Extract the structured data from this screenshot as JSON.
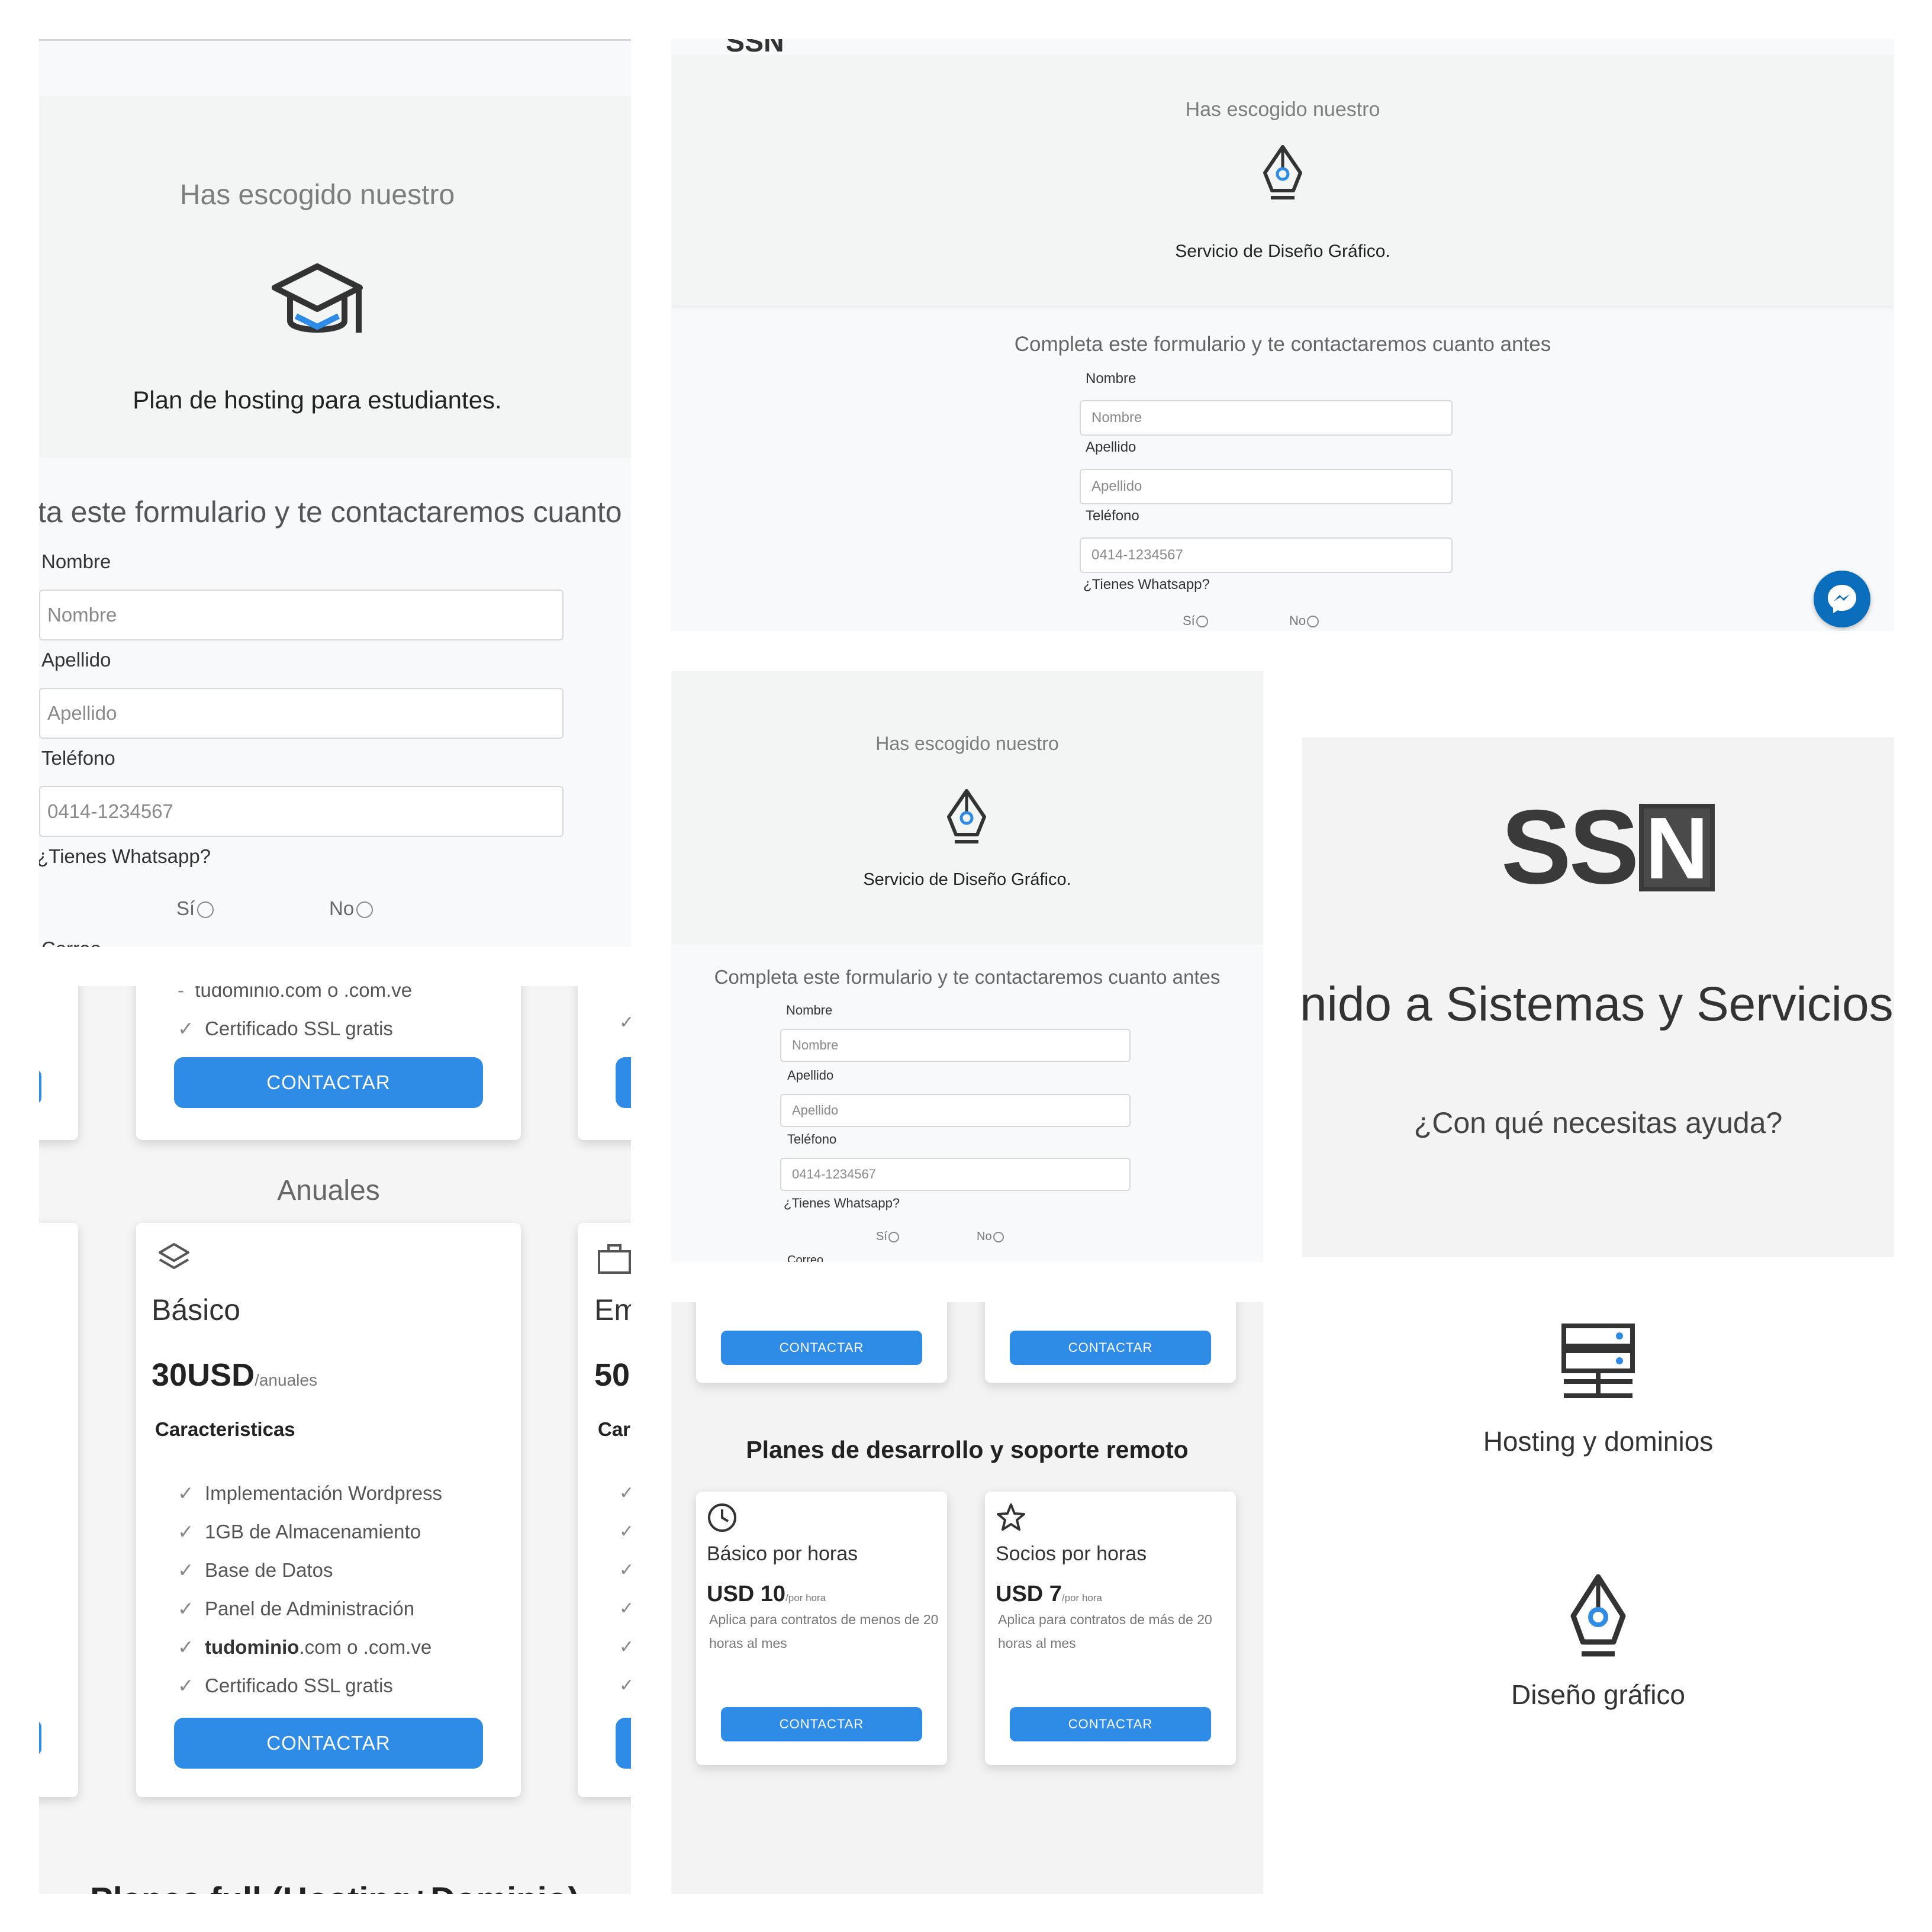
{
  "tile1": {
    "heading": "Has escogido nuestro",
    "plan_name": "Plan de hosting para estudiantes.",
    "form_title": "ta este formulario y te contactaremos cuanto a",
    "nombre_label": "Nombre",
    "nombre_placeholder": "Nombre",
    "apellido_label": "Apellido",
    "apellido_placeholder": "Apellido",
    "telefono_label": "Teléfono",
    "telefono_placeholder": "0414-1234567",
    "whatsapp_label": "¿Tienes Whatsapp?",
    "si_label": "Sí",
    "no_label": "No",
    "correo_label": "Correo"
  },
  "tile2": {
    "logo_partial": "SSN",
    "heading": "Has escogido nuestro",
    "service_name": "Servicio de Diseño Gráfico.",
    "form_title": "Completa este formulario y te contactaremos cuanto antes",
    "nombre_label": "Nombre",
    "nombre_placeholder": "Nombre",
    "apellido_label": "Apellido",
    "apellido_placeholder": "Apellido",
    "telefono_label": "Teléfono",
    "telefono_placeholder": "0414-1234567",
    "whatsapp_label": "¿Tienes Whatsapp?",
    "si_label": "Sí",
    "no_label": "No"
  },
  "tile3": {
    "prev_feature_1": "tudominio.com o .com.ve",
    "prev_feature_2": "Certificado SSL gratis",
    "contact_btn": "CONTACTAR",
    "section_title": "Anuales",
    "card_title": "Básico",
    "price": "30USD",
    "price_period": "/anuales",
    "features_title": "Caracteristicas",
    "features": [
      "Implementación Wordpress",
      "1GB de Almacenamiento",
      "Base de Datos",
      "Panel de Administración",
      "tudominio.com o .com.ve",
      "Certificado SSL gratis"
    ],
    "features_bold_part": "tudominio",
    "features_bold_rest": ".com o .com.ve",
    "right_card_title_partial": "Em",
    "right_card_price_partial": "50",
    "right_card_features_partial": "Car",
    "next_section_partial": "Planes full (Hosting+Dominio)"
  },
  "tile4": {
    "heading": "Has escogido nuestro",
    "service_name": "Servicio de Diseño Gráfico.",
    "form_title": "Completa este formulario y te contactaremos cuanto antes",
    "nombre_label": "Nombre",
    "nombre_placeholder": "Nombre",
    "apellido_label": "Apellido",
    "apellido_placeholder": "Apellido",
    "telefono_label": "Teléfono",
    "telefono_placeholder": "0414-1234567",
    "whatsapp_label": "¿Tienes Whatsapp?",
    "si_label": "Sí",
    "no_label": "No",
    "correo_label": "Correo"
  },
  "tile5": {
    "logo": "SSN",
    "welcome_partial": "nido a Sistemas y Servicios",
    "question": "¿Con qué necesitas ayuda?"
  },
  "tile6": {
    "contact_btn": "CONTACTAR",
    "section_title": "Planes de desarrollo y soporte remoto",
    "cards": [
      {
        "title": "Básico por horas",
        "price": "USD 10",
        "period": "/por hora",
        "desc": "Aplica para contratos de menos de 20 horas al mes",
        "btn": "CONTACTAR"
      },
      {
        "title": "Socios por horas",
        "price": "USD 7",
        "period": "/por hora",
        "desc": "Aplica para contratos de más de 20 horas al mes",
        "btn": "CONTACTAR"
      }
    ]
  },
  "tile7": {
    "services": [
      {
        "label": "Hosting y dominios",
        "icon": "server-icon"
      },
      {
        "label": "Diseño gráfico",
        "icon": "pen-nib-icon"
      }
    ]
  },
  "colors": {
    "accent": "#2e8be6",
    "messenger": "#0a6ebd",
    "band": "#f3f4f4",
    "text": "#333333"
  }
}
